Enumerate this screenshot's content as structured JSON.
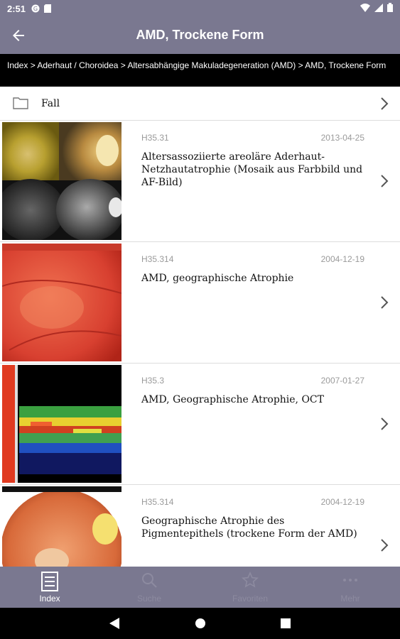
{
  "status_bar": {
    "time": "2:51"
  },
  "app_bar": {
    "title": "AMD, Trockene Form"
  },
  "breadcrumb": "Index > Aderhaut / Choroidea > Altersabhängige Makuladegeneration (AMD) > AMD, Trockene Form",
  "folder": {
    "label": "Fall"
  },
  "items": [
    {
      "code": "H35.31",
      "date": "2013-04-25",
      "title": "Altersassoziierte areoläre Aderhaut-Netzhautatrophie (Mosaik aus Farbbild und AF-Bild)"
    },
    {
      "code": "H35.314",
      "date": "2004-12-19",
      "title": "AMD, geographische Atrophie"
    },
    {
      "code": "H35.3",
      "date": "2007-01-27",
      "title": "AMD, Geographische Atrophie, OCT"
    },
    {
      "code": "H35.314",
      "date": "2004-12-19",
      "title": "Geographische Atrophie des Pigmentepithels (trockene Form der AMD)"
    }
  ],
  "bottom_nav": [
    {
      "label": "Index",
      "icon": "list-icon",
      "active": true
    },
    {
      "label": "Suche",
      "icon": "search-icon",
      "active": false
    },
    {
      "label": "Favoriten",
      "icon": "star-icon",
      "active": false
    },
    {
      "label": "Mehr",
      "icon": "more-icon",
      "active": false
    }
  ],
  "colors": {
    "app_bar": "#7a7890",
    "breadcrumb_bg": "#000000",
    "secondary_text": "#9a9a9a"
  }
}
